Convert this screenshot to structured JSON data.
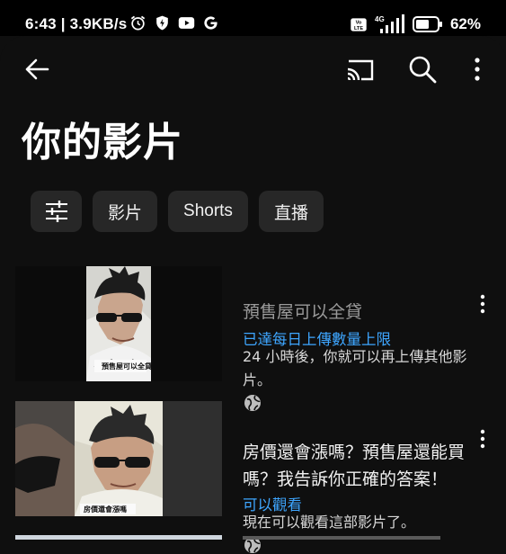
{
  "status_bar": {
    "time_speed": "6:43 | 3.9KB/s",
    "battery": "62%",
    "network": "4G",
    "icons": [
      "alarm-icon",
      "shield-bolt-icon",
      "youtube-icon",
      "google-icon",
      "volte-icon",
      "signal-icon",
      "battery-icon"
    ]
  },
  "appbar": {
    "icons": [
      "back-arrow-icon",
      "cast-icon",
      "search-icon",
      "more-vert-icon"
    ]
  },
  "page": {
    "title": "你的影片"
  },
  "chips": [
    {
      "icon": "filter-sliders-icon",
      "label": ""
    },
    {
      "label": "影片"
    },
    {
      "label": "Shorts"
    },
    {
      "label": "直播"
    }
  ],
  "videos": [
    {
      "title": "預售屋可以全貸",
      "status": "已達每日上傳數量上限",
      "description": "24 小時後，你就可以再上傳其他影片。",
      "visibility_icon": "globe-icon",
      "thumb_caption": "預售屋可以全貸"
    },
    {
      "title": "房價還會漲嗎？預售屋還能買嗎？我告訴你正確的答案！",
      "status": "可以觀看",
      "description": "現在可以觀看這部影片了。",
      "visibility_icon": "globe-icon",
      "thumb_caption": "房價還會漲嗎"
    }
  ],
  "colors": {
    "background": "#0f0f0f",
    "chip": "#272727",
    "link_blue": "#3ea6ff",
    "title_muted": "#9a9a9a"
  }
}
